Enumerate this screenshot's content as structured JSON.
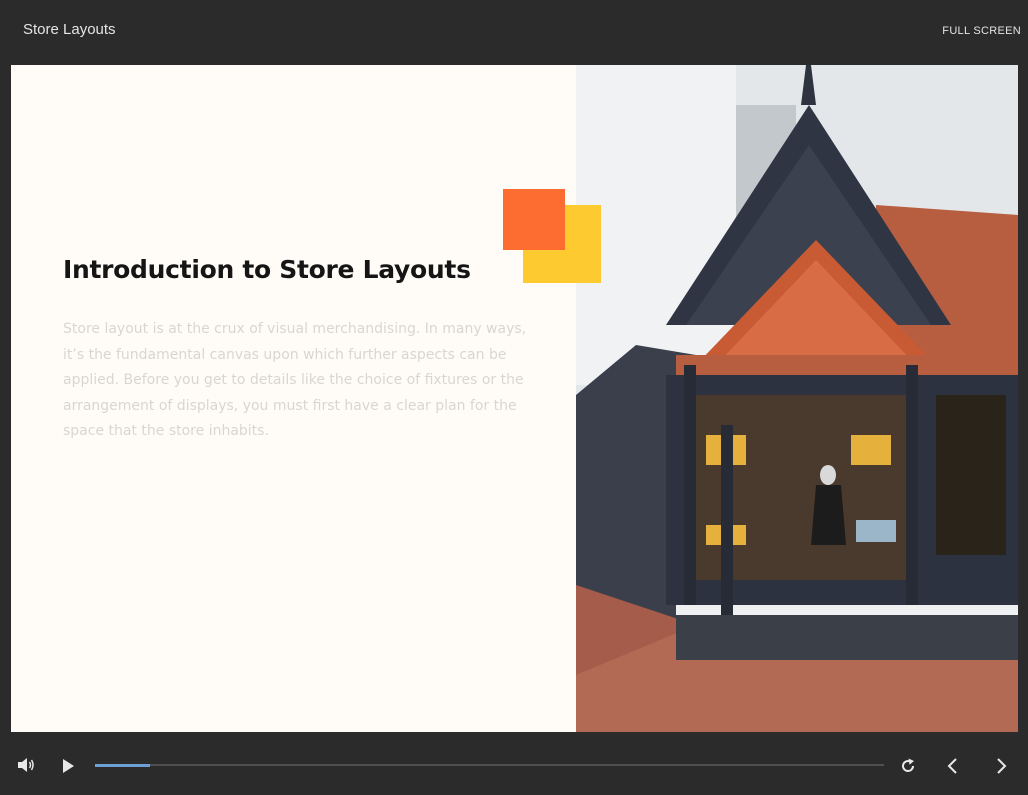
{
  "header": {
    "title": "Store Layouts",
    "fullscreen_label": "FULL SCREEN"
  },
  "slide": {
    "title": "Introduction to Store Layouts",
    "body": "Store layout is at the crux of visual merchandising. In many ways, it’s the fundamental canvas upon which further aspects can be applied. Before you get to details like the choice of fixtures or the arrangement of displays, you must first have a clear plan for the space that the store inhabits."
  },
  "player": {
    "progress_fraction": 0.07,
    "icons": [
      "volume-icon",
      "play-icon",
      "replay-icon",
      "previous-icon",
      "next-icon"
    ]
  },
  "colors": {
    "accent_orange": "#fd6c30",
    "accent_yellow": "#fdcb2f",
    "progress": "#6ea0d8",
    "chrome": "#2b2b2b"
  }
}
